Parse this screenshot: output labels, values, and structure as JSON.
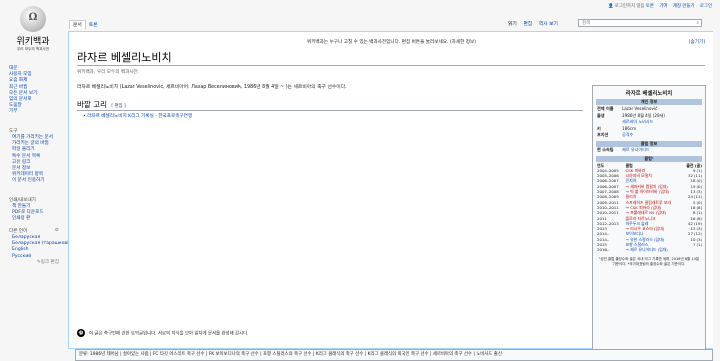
{
  "logo": {
    "wordmark": "위키백과",
    "tagline": "우리 모두의 백과사전",
    "glyph": "Ω"
  },
  "nav_main": [
    "대문",
    "사용자 모임",
    "요즘 화제",
    "최근 바뀜",
    "모든 문서 보기",
    "임의 문서로",
    "도움말",
    "기부"
  ],
  "tools": {
    "heading": "도구",
    "items": [
      "여기를 가리키는 문서",
      "가리키는 글의 바뀜",
      "파일 올리기",
      "특수 문서 목록",
      "고유 링크",
      "문서 정보",
      "위키데이터 항목",
      "이 문서 인용하기"
    ]
  },
  "print": {
    "heading": "인쇄/내보내기",
    "items": [
      "책 만들기",
      "PDF로 다운로드",
      "인쇄용 판"
    ]
  },
  "languages": {
    "heading": "다른 언어",
    "items": [
      "Беларуская",
      "Беларуская (тарашкевіца)",
      "English",
      "Русский"
    ],
    "edit_links": "링크 편집"
  },
  "personal": [
    "로그인하지 않음",
    "토론",
    "기여",
    "계정 만들기",
    "로그인"
  ],
  "tabs_left": [
    "문서",
    "토론"
  ],
  "tabs_right": [
    "읽기",
    "편집",
    "역사 보기"
  ],
  "search": {
    "placeholder": "검색"
  },
  "site_notice": "위키백과는 누구나 고칠 수 있는 백과사전입니다. 편집 버튼을 눌러보세요. (자세한 정보)",
  "notice_hide": "[숨기기]",
  "page": {
    "title": "라자르 베셀리노비치",
    "subtitle": "위키백과, 우리 모두의 백과사전.",
    "lead": "라자르 베셀리노비치 (Lazar Veselinović, 세르비아어: Лазар Веселиновић, 1986년 8월 4일 ~ )는 세르비아의 축구 선수이다.",
    "section_heading": "바깥 고리",
    "section_edit": "[ 편집 ]",
    "ext_link": "라자르 베셀리노비치 K리그 기록실 - 한국프로축구연맹"
  },
  "infobox": {
    "title": "라자르 베셀리노비치",
    "personal_header": "개인 정보",
    "rows": [
      {
        "k": "전체 이름",
        "v": "Lazar Veselinović"
      },
      {
        "k": "출생",
        "v": "1986년 8월 4일 (29세)"
      },
      {
        "k": "",
        "v": "세르비아 노비사드"
      },
      {
        "k": "키",
        "v": "186cm"
      },
      {
        "k": "포지션",
        "v": "공격수"
      }
    ],
    "club_info_header": "클럽 정보",
    "current_club_label": "현 소속팀",
    "current_club": "제르 유나이티드",
    "clubs_header": "클럽¹",
    "col_year": "연도",
    "col_club": "클럽",
    "col_apps": "출전 (골)",
    "clubs": [
      {
        "year": "2004–2005",
        "club": "ČSK 피바라",
        "apps": "9",
        "goals": "(1)"
      },
      {
        "year": "2005–2006",
        "club": "시야지비 모필치",
        "apps": "32",
        "goals": "(11)"
      },
      {
        "year": "2006–2007",
        "club": "인지야",
        "apps": "18",
        "goals": "(0)"
      },
      {
        "year": "2006–2007",
        "club": "→ 세마커비 캠필치 (임대)",
        "apps": "19",
        "goals": "(0)"
      },
      {
        "year": "2007–2008",
        "club": "→ 빅 볼 하이브러바 (임대)",
        "apps": "13",
        "goals": "(3)"
      },
      {
        "year": "2008–2009",
        "club": "밀리치",
        "apps": "24",
        "goals": "(11)"
      },
      {
        "year": "2009–2011",
        "club": "스프레히즈 클럽레트루 보라",
        "apps": "5",
        "goals": "(0)"
      },
      {
        "year": "2010–2011",
        "club": "→ ČSK 피바라 (임대)",
        "apps": "16",
        "goals": "(8)"
      },
      {
        "year": "2010–2011",
        "club": "→ 프롤레테르 N5 (임대)",
        "apps": "8",
        "goals": "(1)"
      },
      {
        "year": "2011",
        "club": "플로리 타르노니크",
        "apps": "16",
        "goals": "(8)"
      },
      {
        "year": "2012–2013",
        "club": "하주두크 슬레",
        "apps": "42",
        "goals": "(19)"
      },
      {
        "year": "2013",
        "club": "→ 리시우 코스타 (임대)",
        "apps": "13",
        "goals": "(3)"
      },
      {
        "year": "2014–",
        "club": "보이보디나",
        "apps": "27",
        "goals": "(12)"
      },
      {
        "year": "2014–",
        "club": "→ 유한 스칼라스 (임대)",
        "apps": "10",
        "goals": "(3)"
      },
      {
        "year": "2015",
        "club": "포항 스틸러스",
        "apps": "7",
        "goals": "(1)"
      },
      {
        "year": "2016–",
        "club": "→ 제르 유나이티드 (임대)",
        "apps": "",
        "goals": ""
      }
    ],
    "footnote": "¹성인 클럽 출장수와 골은 국내 리그 기록만 세며, 2016년 6월 14일 기준이다. *국가대표팀의 출장수와 골은 기준이다."
  },
  "stub_text": "이 글은 축구인에 관한 토막글입니다. 서로의 지식을 모아 알차게 문서를 완성해 갑시다.",
  "categories": "분류: 1986년 태어남 | 살아있는 사람 | FC 타깃 어스리트 축구 선수 | FK 보이보디나의 축구 선수 | 포항 스틸러스의 축구 선수 | K리그 클래식의 축구 선수 | K리그 클래식의 외국인 축구 선수 | 세르비아의 축구 선수 | 노비사드 출신"
}
